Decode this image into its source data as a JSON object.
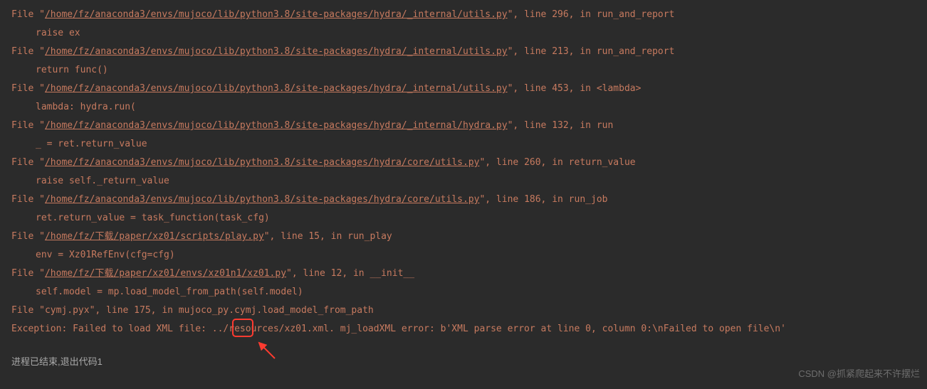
{
  "frames": [
    {
      "path": "/home/fz/anaconda3/envs/mujoco/lib/python3.8/site-packages/hydra/_internal/utils.py",
      "line": "296",
      "func": "run_and_report",
      "code": "raise ex"
    },
    {
      "path": "/home/fz/anaconda3/envs/mujoco/lib/python3.8/site-packages/hydra/_internal/utils.py",
      "line": "213",
      "func": "run_and_report",
      "code": "return func()"
    },
    {
      "path": "/home/fz/anaconda3/envs/mujoco/lib/python3.8/site-packages/hydra/_internal/utils.py",
      "line": "453",
      "func": "<lambda>",
      "code": "lambda: hydra.run("
    },
    {
      "path": "/home/fz/anaconda3/envs/mujoco/lib/python3.8/site-packages/hydra/_internal/hydra.py",
      "line": "132",
      "func": "run",
      "code": "_ = ret.return_value"
    },
    {
      "path": "/home/fz/anaconda3/envs/mujoco/lib/python3.8/site-packages/hydra/core/utils.py",
      "line": "260",
      "func": "return_value",
      "code": "raise self._return_value"
    },
    {
      "path": "/home/fz/anaconda3/envs/mujoco/lib/python3.8/site-packages/hydra/core/utils.py",
      "line": "186",
      "func": "run_job",
      "code": "ret.return_value = task_function(task_cfg)"
    },
    {
      "path": "/home/fz/下载/paper/xz01/scripts/play.py",
      "line": "15",
      "func": "run_play",
      "code": "env = Xz01RefEnv(cfg=cfg)"
    },
    {
      "path": "/home/fz/下载/paper/xz01/envs/xz01n1/xz01.py",
      "line": "12",
      "func": "__init__",
      "code": "self.model = mp.load_model_from_path(self.model)"
    }
  ],
  "last_frame": {
    "prefix": "File \"cymj.pyx\", line 175, in mujoco_py.cymj.load_model_from_path"
  },
  "exception": {
    "prefix": "Exception: Failed to load XML file: ",
    "suffix": "../resources/xz01.xml. mj_loadXML error: b'XML parse error at line 0, column 0:\\nFailed to open file\\n'"
  },
  "exit_message": "进程已结束,退出代码1",
  "watermark": "CSDN @抓紧爬起来不许摆烂",
  "labels": {
    "file_prefix": "File \"",
    "line_prefix": "\", line ",
    "in_prefix": ", in "
  }
}
